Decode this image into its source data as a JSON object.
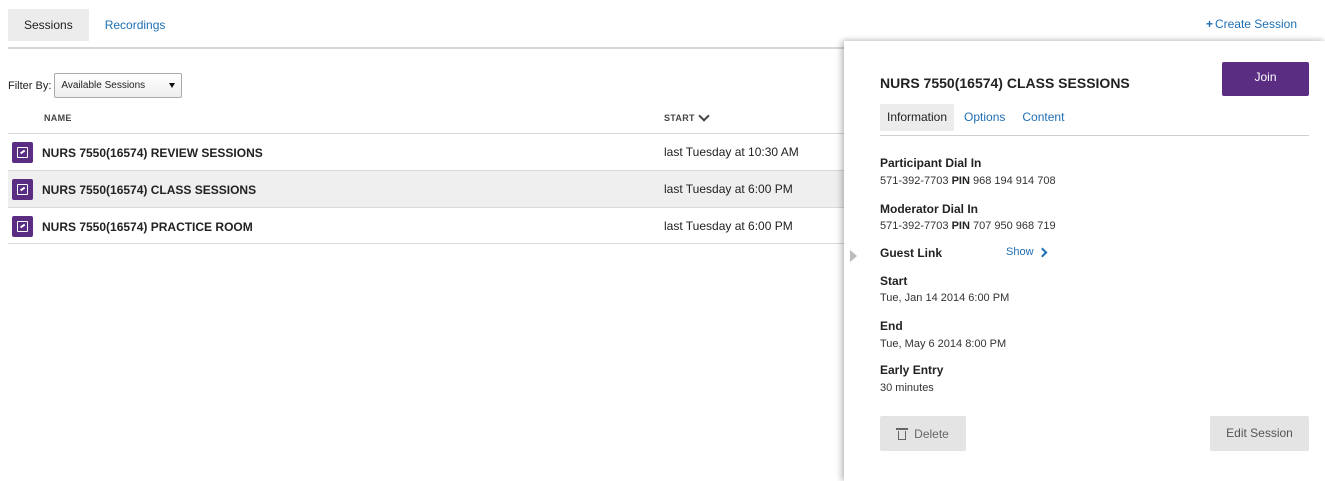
{
  "top_tabs": [
    {
      "label": "Sessions"
    },
    {
      "label": "Recordings"
    }
  ],
  "create_session": {
    "icon": "plus-icon",
    "label": "Create Session"
  },
  "filter": {
    "label": "Filter By:",
    "selected": "Available Sessions"
  },
  "table": {
    "columns": {
      "name": "NAME",
      "start": "START"
    },
    "rows": [
      {
        "name": "NURS 7550(16574) REVIEW SESSIONS",
        "start": "last Tuesday at 10:30 AM",
        "selected": false
      },
      {
        "name": "NURS 7550(16574) CLASS SESSIONS",
        "start": "last Tuesday at 6:00 PM",
        "selected": true
      },
      {
        "name": "NURS 7550(16574) PRACTICE ROOM",
        "start": "last Tuesday at 6:00 PM",
        "selected": false
      }
    ]
  },
  "panel": {
    "title": "NURS 7550(16574) CLASS SESSIONS",
    "join_label": "Join",
    "tabs": [
      {
        "label": "Information"
      },
      {
        "label": "Options"
      },
      {
        "label": "Content"
      }
    ],
    "participant": {
      "label": "Participant Dial In",
      "phone": "571-392-7703",
      "pin_label": "PIN",
      "pin": "968 194 914 708"
    },
    "moderator": {
      "label": "Moderator Dial In",
      "phone": "571-392-7703",
      "pin_label": "PIN",
      "pin": "707 950 968 719"
    },
    "guest_link": {
      "label": "Guest Link",
      "show_label": "Show"
    },
    "start": {
      "label": "Start",
      "value": "Tue, Jan 14 2014 6:00 PM"
    },
    "end": {
      "label": "End",
      "value": "Tue, May 6 2014 8:00 PM"
    },
    "early_entry": {
      "label": "Early Entry",
      "value": "30 minutes"
    },
    "delete_label": "Delete",
    "edit_label": "Edit Session"
  },
  "colors": {
    "accent": "#5a2d82",
    "link": "#1e6fb4"
  }
}
